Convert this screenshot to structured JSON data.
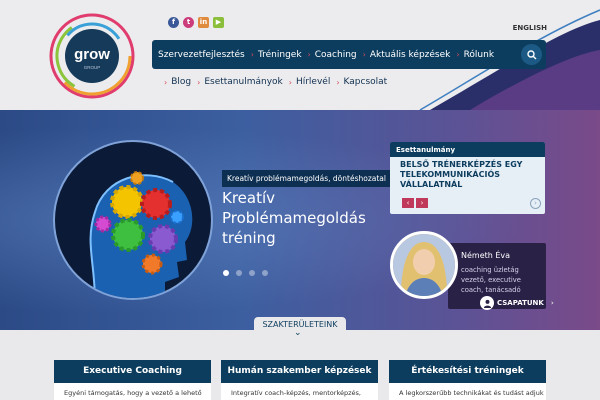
{
  "header": {
    "logo": {
      "word": "grow",
      "sub": "GROUP"
    },
    "social": [
      {
        "name": "facebook-icon",
        "glyph": "f",
        "color": "#3b5998"
      },
      {
        "name": "twitter-icon",
        "glyph": "t",
        "color": "#cc3b7a"
      },
      {
        "name": "linkedin-icon",
        "glyph": "in",
        "color": "#e08a3d"
      },
      {
        "name": "youtube-icon",
        "glyph": "▶",
        "color": "#8bbf3b"
      }
    ],
    "language": "ENGLISH",
    "main_nav": [
      "Szervezetfejlesztés",
      "Tréningek",
      "Coaching",
      "Aktuális képzések",
      "Rólunk"
    ],
    "sub_nav": [
      "Blog",
      "Esettanulmányok",
      "Hírlevél",
      "Kapcsolat"
    ]
  },
  "hero": {
    "tag": "Kreatív problémamegoldás, döntéshozatal",
    "title": "Kreatív Problémamegoldás tréning",
    "slide_count": 4,
    "active_slide": 1
  },
  "case_study": {
    "label": "Esettanulmány",
    "title": "BELSŐ TRÉNERKÉPZÉS EGY TELEKOMMUNIKÁCIÓS VÁLLALATNÁL",
    "prev": "‹",
    "next": "›"
  },
  "person": {
    "name": "Németh Éva",
    "role": "coaching üzletág vezető, executive coach, tanácsadó",
    "team_button": "CSAPATUNK"
  },
  "expertise_tab": "SZAKTERÜLETEINK",
  "cards": [
    {
      "title": "Executive Coaching",
      "text": "Egyéni támogatás, hogy a vezető a lehető"
    },
    {
      "title": "Humán szakember képzések",
      "text": "Integratív coach-képzés, mentorképzés,"
    },
    {
      "title": "Értékesítési tréningek",
      "text": "A legkorszerűbb technikákat és tudást adjuk"
    }
  ],
  "colors": {
    "navy": "#0d3d5e",
    "accent": "#d84a5a",
    "hero_start": "#2b4a86",
    "hero_end": "#7a4a89"
  }
}
